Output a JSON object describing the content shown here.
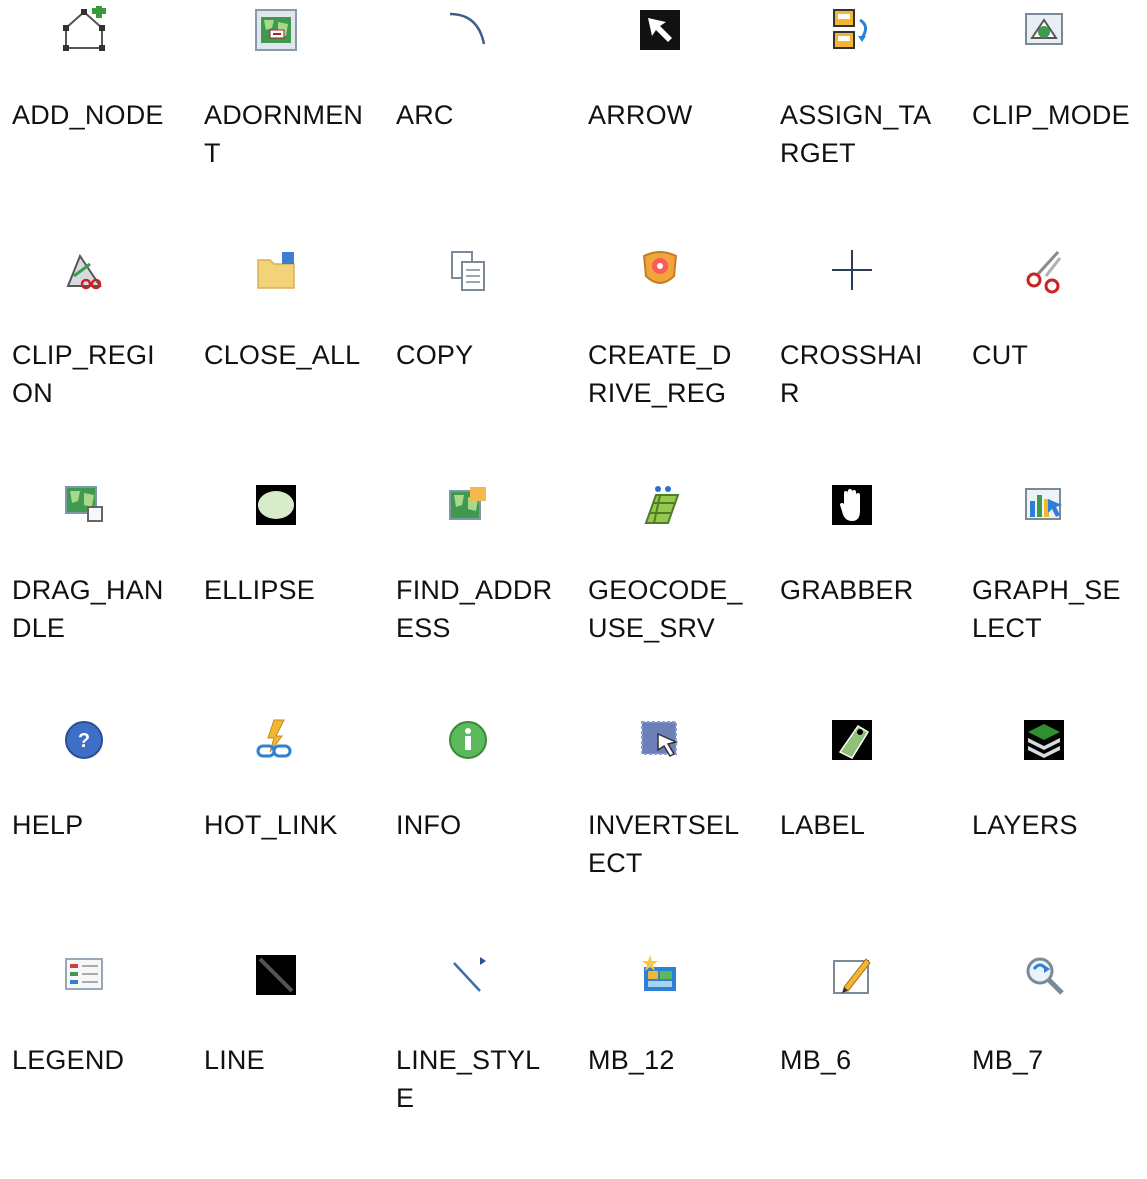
{
  "icons": [
    {
      "label": "ADD_NODE",
      "icon": "add-node-icon"
    },
    {
      "label": "ADORNMENT",
      "icon": "adornment-icon"
    },
    {
      "label": "ARC",
      "icon": "arc-icon"
    },
    {
      "label": "ARROW",
      "icon": "arrow-icon"
    },
    {
      "label": "ASSIGN_TARGET",
      "icon": "assign-target-icon"
    },
    {
      "label": "CLIP_MODE",
      "icon": "clip-mode-icon"
    },
    {
      "label": "CLIP_REGION",
      "icon": "clip-region-icon"
    },
    {
      "label": "CLOSE_ALL",
      "icon": "close-all-icon"
    },
    {
      "label": "COPY",
      "icon": "copy-icon"
    },
    {
      "label": "CREATE_DRIVE_REG",
      "icon": "create-drive-reg-icon"
    },
    {
      "label": "CROSSHAIR",
      "icon": "crosshair-icon"
    },
    {
      "label": "CUT",
      "icon": "cut-icon"
    },
    {
      "label": "DRAG_HANDLE",
      "icon": "drag-handle-icon"
    },
    {
      "label": "ELLIPSE",
      "icon": "ellipse-icon"
    },
    {
      "label": "FIND_ADDRESS",
      "icon": "find-address-icon"
    },
    {
      "label": "GEOCODE_USE_SRV",
      "icon": "geocode-use-srv-icon"
    },
    {
      "label": "GRABBER",
      "icon": "grabber-icon"
    },
    {
      "label": "GRAPH_SELECT",
      "icon": "graph-select-icon"
    },
    {
      "label": "HELP",
      "icon": "help-icon"
    },
    {
      "label": "HOT_LINK",
      "icon": "hot-link-icon"
    },
    {
      "label": "INFO",
      "icon": "info-icon"
    },
    {
      "label": "INVERTSELECT",
      "icon": "invertselect-icon"
    },
    {
      "label": "LABEL",
      "icon": "label-icon"
    },
    {
      "label": "LAYERS",
      "icon": "layers-icon"
    },
    {
      "label": "LEGEND",
      "icon": "legend-icon"
    },
    {
      "label": "LINE",
      "icon": "line-icon"
    },
    {
      "label": "LINE_STYLE",
      "icon": "line-style-icon"
    },
    {
      "label": "MB_12",
      "icon": "mb-12-icon"
    },
    {
      "label": "MB_6",
      "icon": "mb-6-icon"
    },
    {
      "label": "MB_7",
      "icon": "mb-7-icon"
    }
  ]
}
